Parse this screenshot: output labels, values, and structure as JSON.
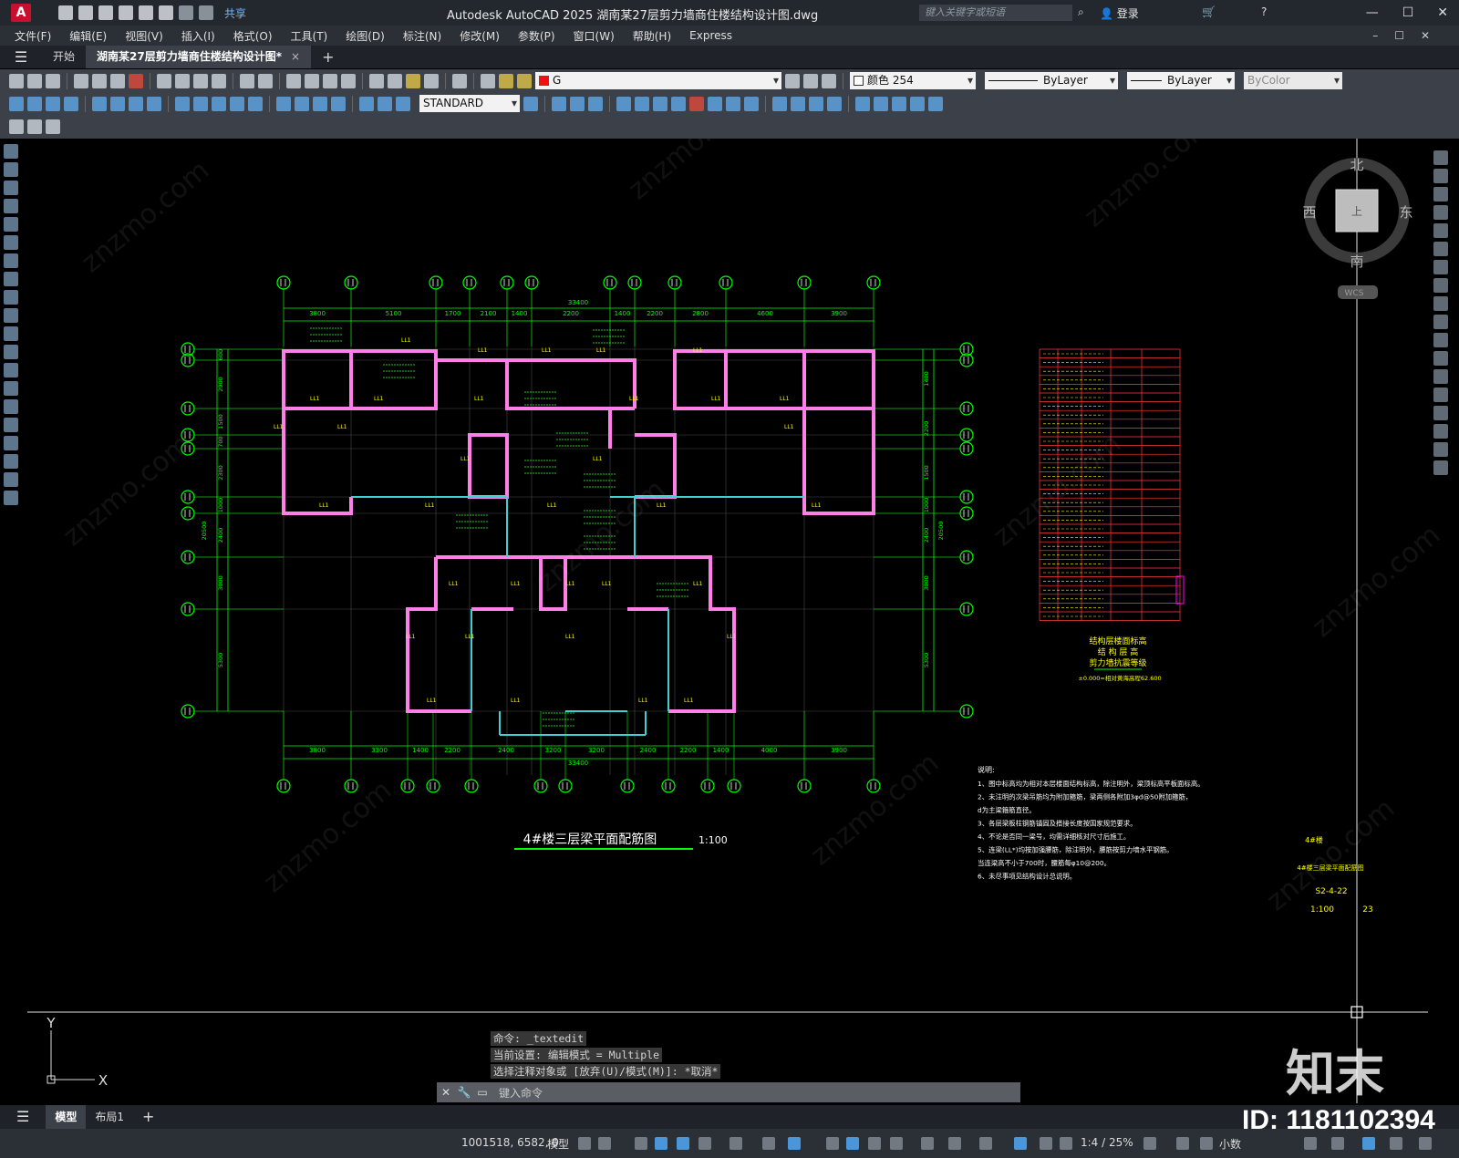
{
  "titlebar": {
    "app_logo": "A",
    "share": "共享",
    "title": "Autodesk AutoCAD 2025    湖南某27层剪力墙商住楼结构设计图.dwg",
    "search_placeholder": "键入关键字或短语",
    "login": "登录"
  },
  "menu": [
    "文件(F)",
    "编辑(E)",
    "视图(V)",
    "插入(I)",
    "格式(O)",
    "工具(T)",
    "绘图(D)",
    "标注(N)",
    "修改(M)",
    "参数(P)",
    "窗口(W)",
    "帮助(H)",
    "Express"
  ],
  "tabs": {
    "start": "开始",
    "document": "湖南某27层剪力墙商住楼结构设计图*",
    "close": "×",
    "new": "+"
  },
  "toolbar": {
    "layer": "G",
    "color": "颜色 254",
    "linetype": "ByLayer",
    "lineweight": "ByLayer",
    "plotstyle": "ByColor",
    "textstyle": "STANDARD"
  },
  "viewcube": {
    "north": "北",
    "south": "南",
    "east": "东",
    "west": "西",
    "top": "上",
    "wcs": "WCS"
  },
  "drawing": {
    "title": "4#楼三层梁平面配筋图",
    "scale": "1:100",
    "overall_dim": "33400",
    "top_dims": [
      "3800",
      "5100",
      "1700",
      "2100",
      "1400",
      "2200",
      "1400",
      "2200",
      "2800",
      "4600",
      "3900"
    ],
    "bottom_dims": [
      "3800",
      "3300",
      "1400",
      "2200",
      "2400",
      "3200",
      "3200",
      "2400",
      "2200",
      "1400",
      "4000",
      "3900"
    ],
    "left_dims": [
      "600",
      "2900",
      "1500",
      "700",
      "2300",
      "1000",
      "2400",
      "3000",
      "5300",
      "20500"
    ],
    "right_dims": [
      "1400",
      "2200",
      "1500",
      "1000",
      "2400",
      "3000",
      "5300",
      "20500"
    ],
    "story_table_caption": [
      "结构层楼面标高",
      "结 构 层 高",
      "剪力墙抗震等级"
    ],
    "story_table_note": "±0.000=相对黄海高程62.600",
    "notes_title": "说明:",
    "notes": [
      "1、图中标高均为相对本层楼面结构标高，除注明外，梁顶标高平板面标高。",
      "2、未注明的次梁吊筋均为附加箍筋，梁两侧各附加3φd@50附加箍筋，",
      "    d为主梁箍筋直径。",
      "3、各层梁板柱钢筋锚固及搭接长度按国家规范要求。",
      "4、不论是否同一梁号，均需详细核对尺寸后施工。",
      "5、连梁(LL*)均按加强腰筋，除注明外，腰筋按剪力墙水平钢筋。",
      "    当连梁高不小于700时，腰筋每φ10@200。",
      "6、未尽事项见结构设计总说明。"
    ],
    "sheet_block": [
      "4#楼",
      "4#楼三层梁平面配筋图",
      "S2-4-22",
      "1:100",
      "23"
    ]
  },
  "command": {
    "history": [
      "命令: _textedit",
      "当前设置: 编辑模式 = Multiple",
      "选择注释对象或 [放弃(U)/模式(M)]: *取消*"
    ],
    "placeholder": "键入命令"
  },
  "layouts": [
    "模型",
    "布局1",
    "+"
  ],
  "status": {
    "coords": "1001518, 6582, 0",
    "model": "模型",
    "scale": "1:4 / 25%",
    "units": "小数"
  },
  "watermark": {
    "brand": "知末",
    "id": "ID: 1181102394",
    "site": "znzmo.com"
  },
  "colors": {
    "wall": "#ff7fe8",
    "axis": "#00ff00",
    "dims": "#00ff00",
    "table": "#ff3a3a",
    "text": "#ffff00",
    "cyan": "#3fd0d0"
  }
}
